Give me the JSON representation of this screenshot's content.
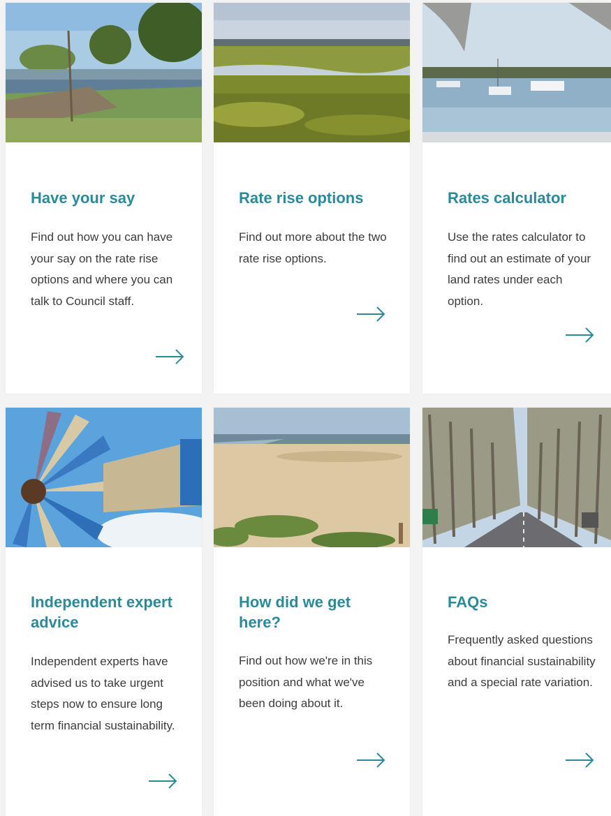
{
  "accent_color": "#2b8a9a",
  "cards": [
    {
      "title": "Have your say",
      "description": "Find out how you can have your say on the rate rise options and where you can talk to Council staff.",
      "arrow_icon": "arrow-right-icon"
    },
    {
      "title": "Rate rise options",
      "description": "Find out more about the two rate rise options.",
      "arrow_icon": "arrow-right-icon"
    },
    {
      "title": "Rates calculator",
      "description": "Use the rates calculator to find out an estimate of your land rates under each option.",
      "arrow_icon": "arrow-right-icon"
    },
    {
      "title": "Independent expert advice",
      "description": "Independent experts have advised us to take urgent steps now to ensure long term financial sustainability.",
      "arrow_icon": "arrow-right-icon"
    },
    {
      "title": "How did we get here?",
      "description": "Find out how we're in this position and what we've been doing about it.",
      "arrow_icon": "arrow-right-icon"
    },
    {
      "title": "FAQs",
      "description": "Frequently asked questions about financial sustainability and a special rate variation.",
      "arrow_icon": "arrow-right-icon"
    }
  ]
}
